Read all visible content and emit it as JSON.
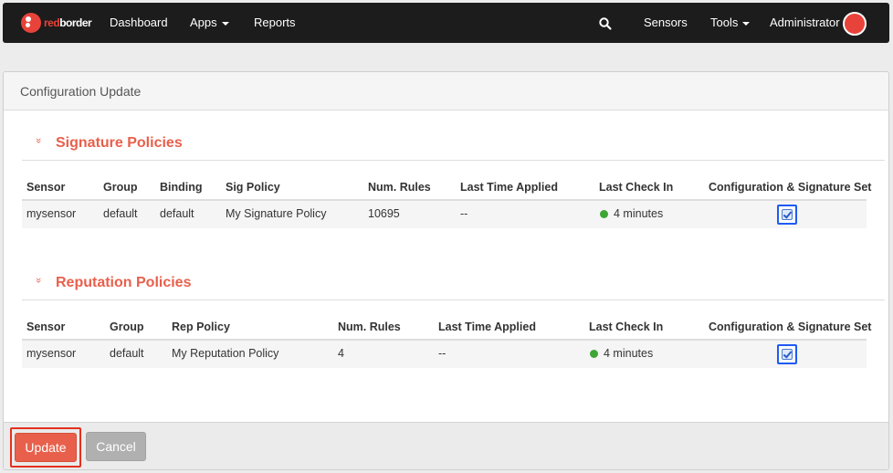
{
  "nav": {
    "brand_prefix": "red",
    "brand_suffix": "border",
    "left_items": [
      "Dashboard",
      "Apps",
      "Reports"
    ],
    "right_items": [
      "Sensors",
      "Tools",
      "Administrator"
    ]
  },
  "panel": {
    "title": "Configuration Update"
  },
  "signature": {
    "title": "Signature Policies",
    "headers": [
      "Sensor",
      "Group",
      "Binding",
      "Sig Policy",
      "Num. Rules",
      "Last Time Applied",
      "Last Check In",
      "Configuration & Signature Set"
    ],
    "row": [
      "mysensor",
      "default",
      "default",
      "My Signature Policy",
      "10695",
      "--",
      "4 minutes"
    ],
    "checked": true
  },
  "reputation": {
    "title": "Reputation Policies",
    "headers": [
      "Sensor",
      "Group",
      "Rep Policy",
      "Num. Rules",
      "Last Time Applied",
      "Last Check In",
      "Configuration & Signature Set"
    ],
    "row": [
      "mysensor",
      "default",
      "My Reputation Policy",
      "4",
      "--",
      "4 minutes"
    ],
    "checked": true
  },
  "buttons": {
    "update": "Update",
    "cancel": "Cancel"
  },
  "colors": {
    "brand": "#e8433a",
    "accent": "#e8604c",
    "online": "#3fa535",
    "focus": "#1e5af5"
  }
}
